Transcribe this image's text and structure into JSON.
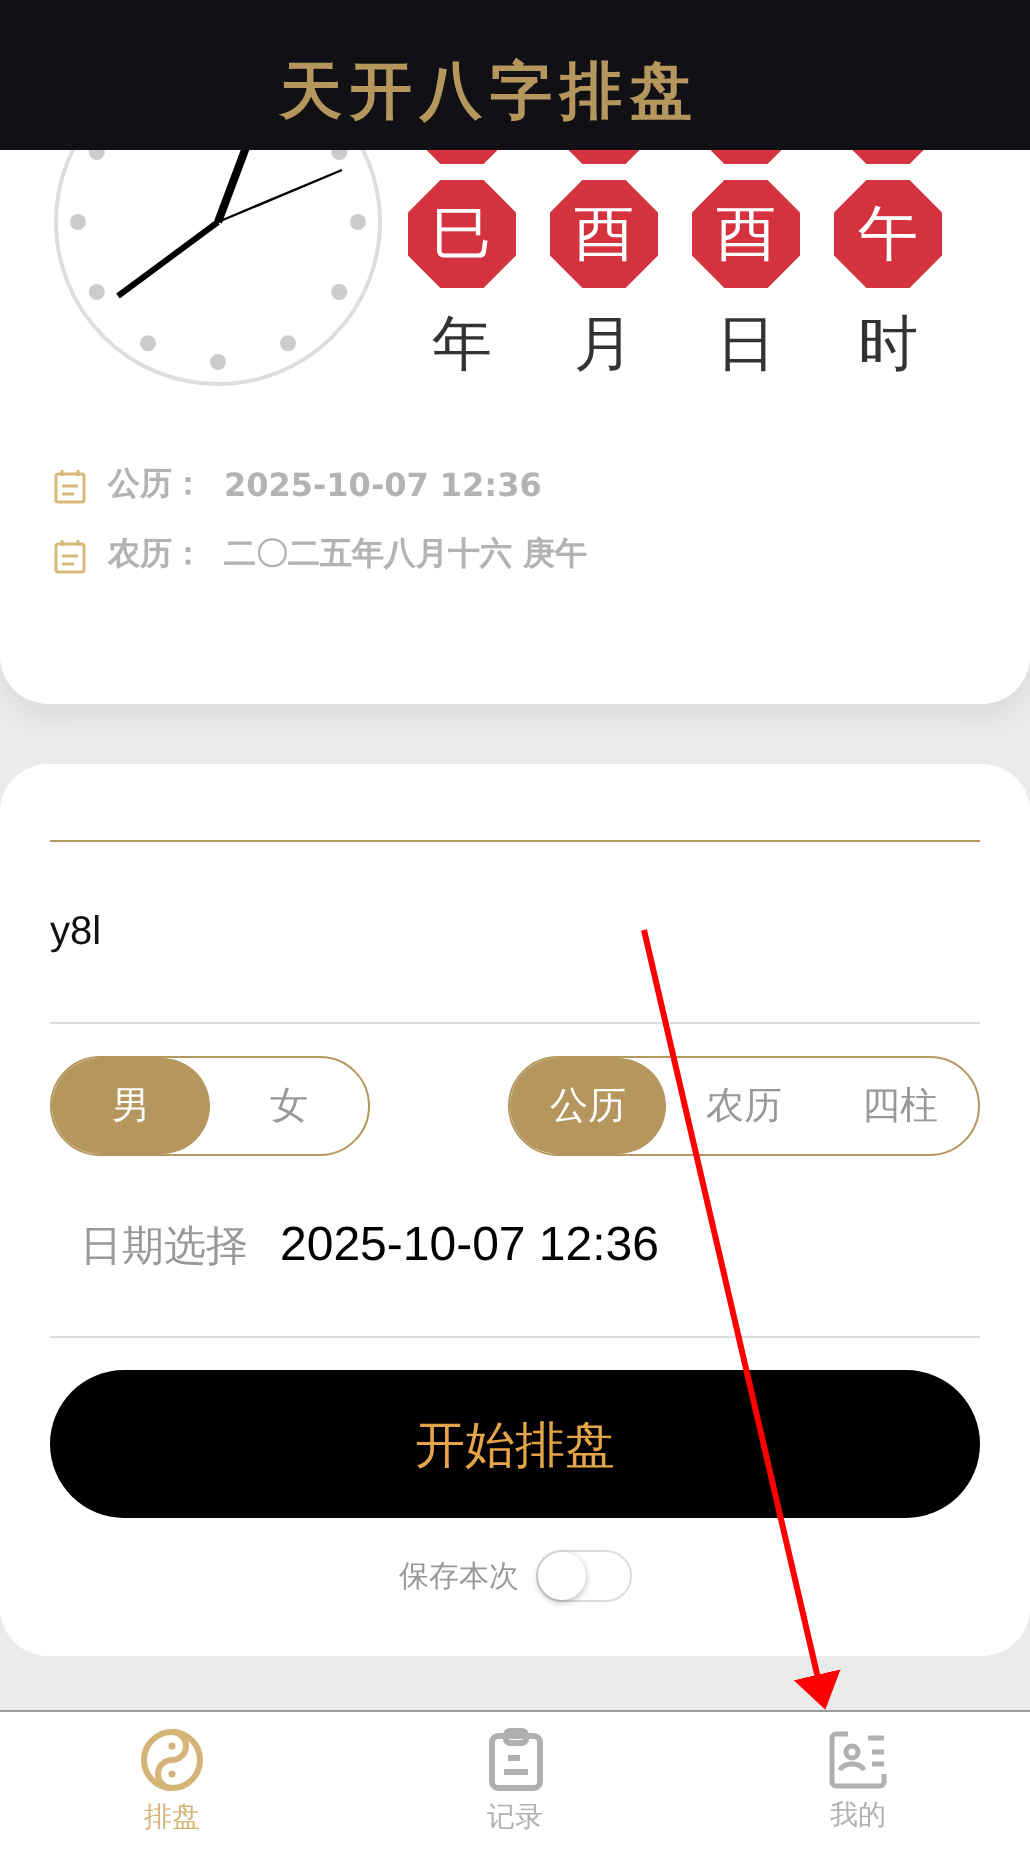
{
  "header": {
    "title": "天开八字排盘"
  },
  "bazi": {
    "columns": [
      {
        "branch": "巳",
        "label": "年"
      },
      {
        "branch": "酉",
        "label": "月"
      },
      {
        "branch": "酉",
        "label": "日"
      },
      {
        "branch": "午",
        "label": "时"
      }
    ]
  },
  "dates": [
    {
      "label": "公历：",
      "value": "2025-10-07 12:36"
    },
    {
      "label": "农历：",
      "value": "二〇二五年八月十六 庚午"
    }
  ],
  "form": {
    "name_value": "y8l",
    "gender": [
      {
        "label": "男",
        "selected": true
      },
      {
        "label": "女",
        "selected": false
      }
    ],
    "calendar": [
      {
        "label": "公历",
        "selected": true
      },
      {
        "label": "农历",
        "selected": false
      },
      {
        "label": "四柱",
        "selected": false
      }
    ],
    "date_label": "日期选择",
    "date_value": "2025-10-07 12:36",
    "submit": "开始排盘",
    "save": {
      "label": "保存本次",
      "on": false
    }
  },
  "tabs": [
    {
      "label": "排盘",
      "selected": true,
      "kind": "yinyang"
    },
    {
      "label": "记录",
      "selected": false,
      "kind": "clipboard"
    },
    {
      "label": "我的",
      "selected": false,
      "kind": "profile"
    }
  ],
  "annotation": {
    "kind": "arrow"
  }
}
